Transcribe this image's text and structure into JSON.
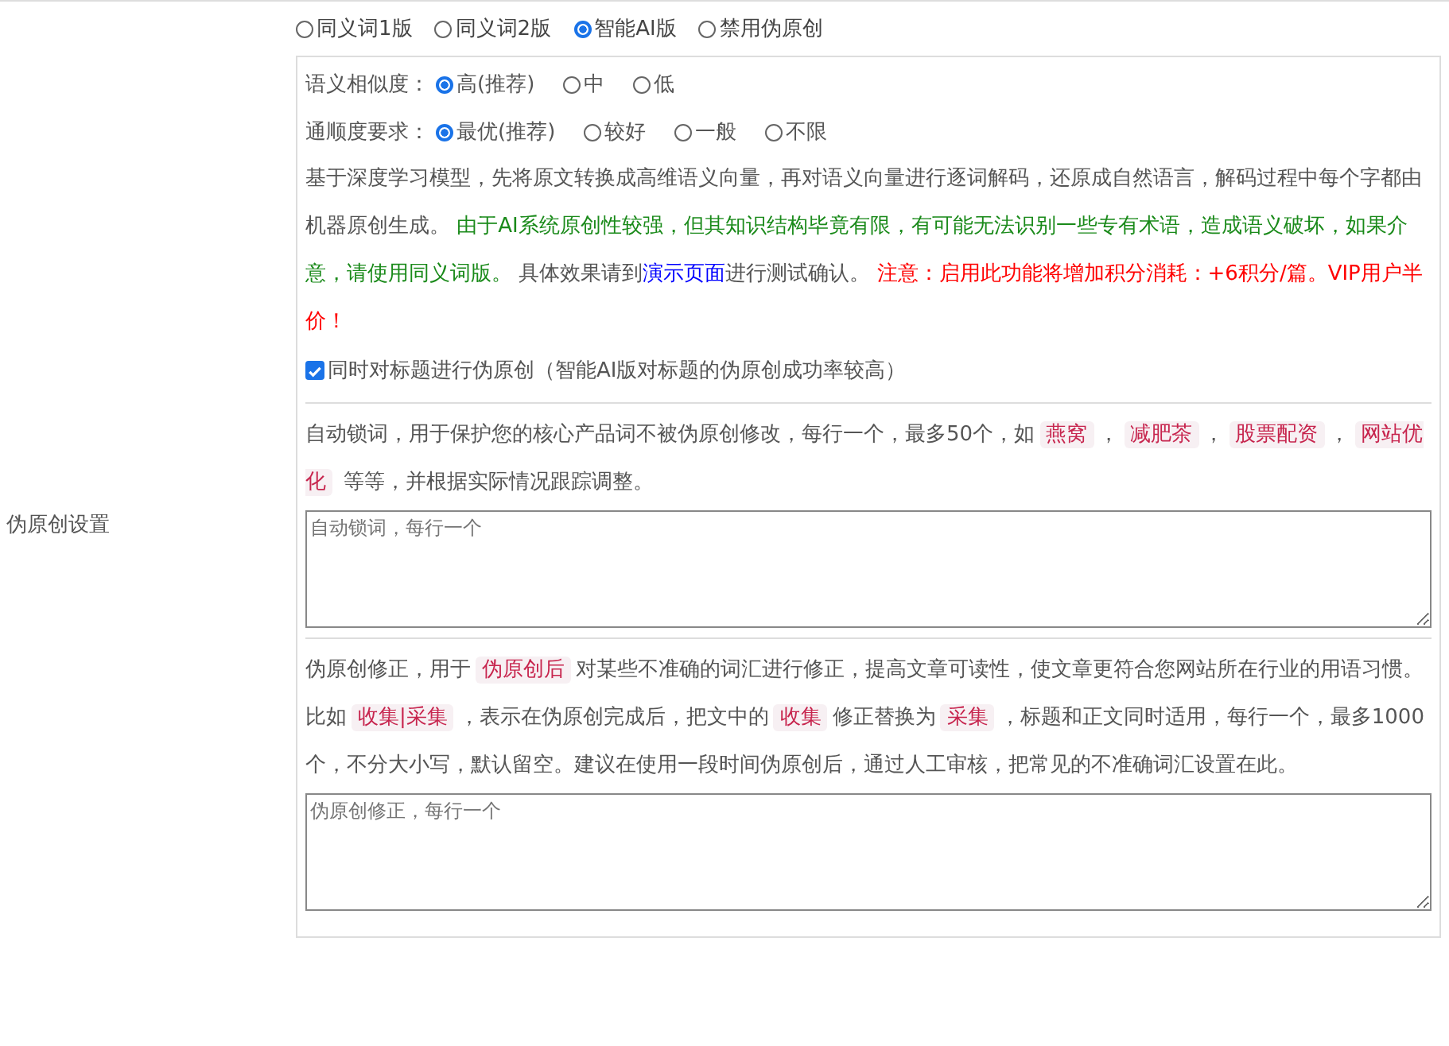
{
  "section_label": "伪原创设置",
  "modes": [
    {
      "label": "同义词1版",
      "selected": false
    },
    {
      "label": "同义词2版",
      "selected": false
    },
    {
      "label": "智能AI版",
      "selected": true
    },
    {
      "label": "禁用伪原创",
      "selected": false
    }
  ],
  "option_groups": [
    {
      "label": "语义相似度：",
      "options": [
        {
          "label": "高(推荐)",
          "selected": true
        },
        {
          "label": "中",
          "selected": false
        },
        {
          "label": "低",
          "selected": false
        }
      ]
    },
    {
      "label": "通顺度要求：",
      "options": [
        {
          "label": "最优(推荐)",
          "selected": true
        },
        {
          "label": "较好",
          "selected": false
        },
        {
          "label": "一般",
          "selected": false
        },
        {
          "label": "不限",
          "selected": false
        }
      ]
    }
  ],
  "description": [
    {
      "kind": "text",
      "text": "基于深度学习模型，先将原文转换成高维语义向量，再对语义向量进行逐词解码，还原成自然语言，解码过程中每个字都由机器原创生成。 "
    },
    {
      "kind": "green",
      "text": "由于AI系统原创性较强，但其知识结构毕竟有限，有可能无法识别一些专有术语，造成语义破坏，如果介意，请使用同义词版。"
    },
    {
      "kind": "text",
      "text": " 具体效果请到"
    },
    {
      "kind": "link",
      "text": "演示页面"
    },
    {
      "kind": "text",
      "text": "进行测试确认。 "
    },
    {
      "kind": "red",
      "text": "注意：启用此功能将增加积分消耗：+6积分/篇。VIP用户半价！"
    }
  ],
  "title_option": {
    "label": "同时对标题进行伪原创（智能AI版对标题的伪原创成功率较高）",
    "checked": true
  },
  "lock_words": {
    "text": [
      {
        "kind": "text",
        "text": "自动锁词，用于保护您的核心产品词不被伪原创修改，每行一个，最多50个，如"
      },
      {
        "kind": "chip",
        "text": "燕窝"
      },
      {
        "kind": "text",
        "text": "，"
      },
      {
        "kind": "chip",
        "text": "减肥茶"
      },
      {
        "kind": "text",
        "text": "，"
      },
      {
        "kind": "chip",
        "text": "股票配资"
      },
      {
        "kind": "text",
        "text": "，"
      },
      {
        "kind": "chip",
        "text": "网站优化"
      },
      {
        "kind": "text",
        "text": " 等等，并根据实际情况跟踪调整。"
      }
    ],
    "placeholder": "自动锁词，每行一个"
  },
  "corrections": {
    "text": [
      {
        "kind": "text",
        "text": "伪原创修正，用于"
      },
      {
        "kind": "chip",
        "text": "伪原创后"
      },
      {
        "kind": "text",
        "text": "对某些不准确的词汇进行修正，提高文章可读性，使文章更符合您网站所在行业的用语习惯。比如"
      },
      {
        "kind": "chip",
        "text": "收集|采集"
      },
      {
        "kind": "text",
        "text": "，表示在伪原创完成后，把文中的"
      },
      {
        "kind": "chip",
        "text": "收集"
      },
      {
        "kind": "text",
        "text": "修正替换为"
      },
      {
        "kind": "chip",
        "text": "采集"
      },
      {
        "kind": "text",
        "text": "，标题和正文同时适用，每行一个，最多1000个，不分大小写，默认留空。建议在使用一段时间伪原创后，通过人工审核，把常见的不准确词汇设置在此。"
      }
    ],
    "placeholder": "伪原创修正，每行一个"
  }
}
